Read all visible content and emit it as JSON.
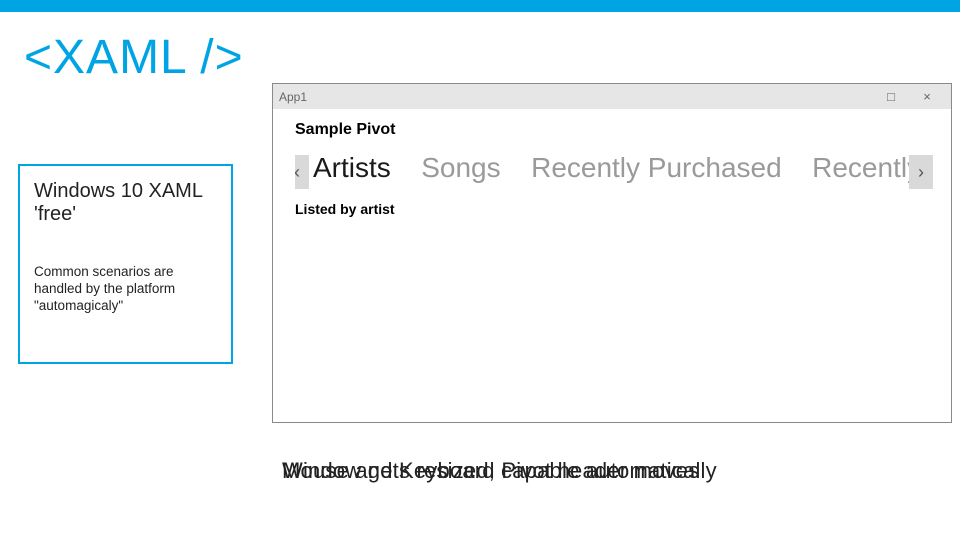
{
  "slide": {
    "title": "<XAML />"
  },
  "card": {
    "title": "Windows 10 XAML 'free'",
    "body": "Common scenarios are handled by the platform \"automagicaly\""
  },
  "app": {
    "name": "App1",
    "titlebar": {
      "maximize_glyph": "□",
      "close_glyph": "×"
    },
    "heading": "Sample Pivot",
    "pivot": {
      "prev_glyph": "‹",
      "next_glyph": "›",
      "items": [
        {
          "label": "Artists",
          "active": true
        },
        {
          "label": "Songs",
          "active": false
        },
        {
          "label": "Recently Purchased",
          "active": false
        },
        {
          "label": "Recently cently Purc",
          "active": false
        }
      ]
    },
    "subheading": "Listed by artist"
  },
  "caption": {
    "layer1": "Window gets resized, Pivot header moves",
    "layer2": "Mouse and Keyboard capable automatically"
  }
}
